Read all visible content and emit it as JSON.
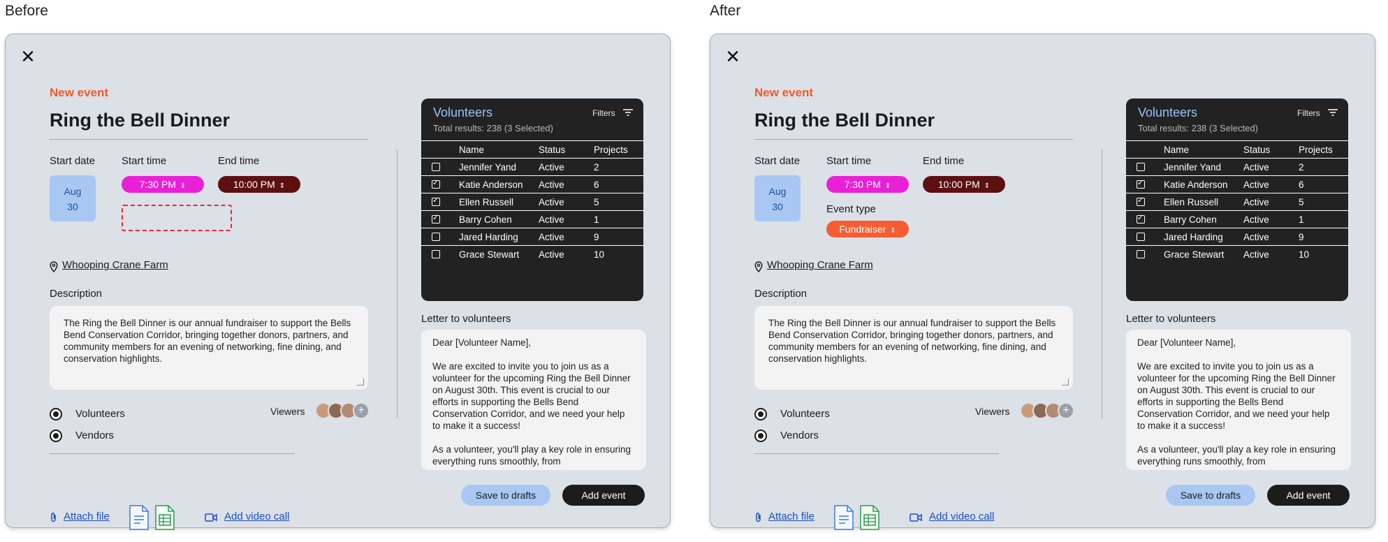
{
  "captions": {
    "before": "Before",
    "after": "After"
  },
  "form": {
    "close_icon": "✕",
    "kicker": "New event",
    "title": "Ring the Bell Dinner",
    "start_date_label": "Start date",
    "start_time_label": "Start time",
    "end_time_label": "End time",
    "date_month": "Aug",
    "date_day": "30",
    "start_time": "7:30 PM",
    "end_time": "10:00 PM",
    "event_type_label": "Event type",
    "event_type": "Fundraiser",
    "location": "Whooping Crane Farm",
    "description_label": "Description",
    "description": "The Ring the Bell Dinner is our annual fundraiser to support the Bells Bend Conservation Corridor, bringing together donors, partners, and community members for an evening of networking, fine dining, and conservation highlights.",
    "radios": [
      "Volunteers",
      "Vendors"
    ],
    "viewers_label": "Viewers",
    "add_viewer_icon": "+",
    "attach_file": "Attach file",
    "add_video_call": "Add video call",
    "letter_label": "Letter to volunteers",
    "letter": {
      "greeting": "Dear [Volunteer Name],",
      "p1": "We are excited to invite you to join us as a volunteer for the upcoming Ring the Bell Dinner on August 30th. This event is crucial to our efforts in supporting the Bells Bend Conservation Corridor, and we need your help to make it a success!",
      "p2": "As a volunteer, you'll play a key role in ensuring everything runs smoothly, from"
    },
    "save_drafts": "Save to drafts",
    "add_event": "Add event"
  },
  "volunteers": {
    "title": "Volunteers",
    "subtitle": "Total results: 238 (3 Selected)",
    "filters": "Filters",
    "columns": [
      "Name",
      "Status",
      "Projects"
    ],
    "rows": [
      {
        "name": "Jennifer Yand",
        "status": "Active",
        "projects": "2",
        "checked": false
      },
      {
        "name": "Katie Anderson",
        "status": "Active",
        "projects": "6",
        "checked": true
      },
      {
        "name": "Ellen Russell",
        "status": "Active",
        "projects": "5",
        "checked": true
      },
      {
        "name": "Barry Cohen",
        "status": "Active",
        "projects": "1",
        "checked": true
      },
      {
        "name": "Jared Harding",
        "status": "Active",
        "projects": "9",
        "checked": false
      },
      {
        "name": "Grace Stewart",
        "status": "Active",
        "projects": "10",
        "checked": false
      }
    ]
  },
  "colors": {
    "accent": "#f05a2a",
    "start_pill": "#ea20d6",
    "end_pill": "#5c1010",
    "type_pill": "#f75d33",
    "date_chip": "#a8c8f3"
  }
}
